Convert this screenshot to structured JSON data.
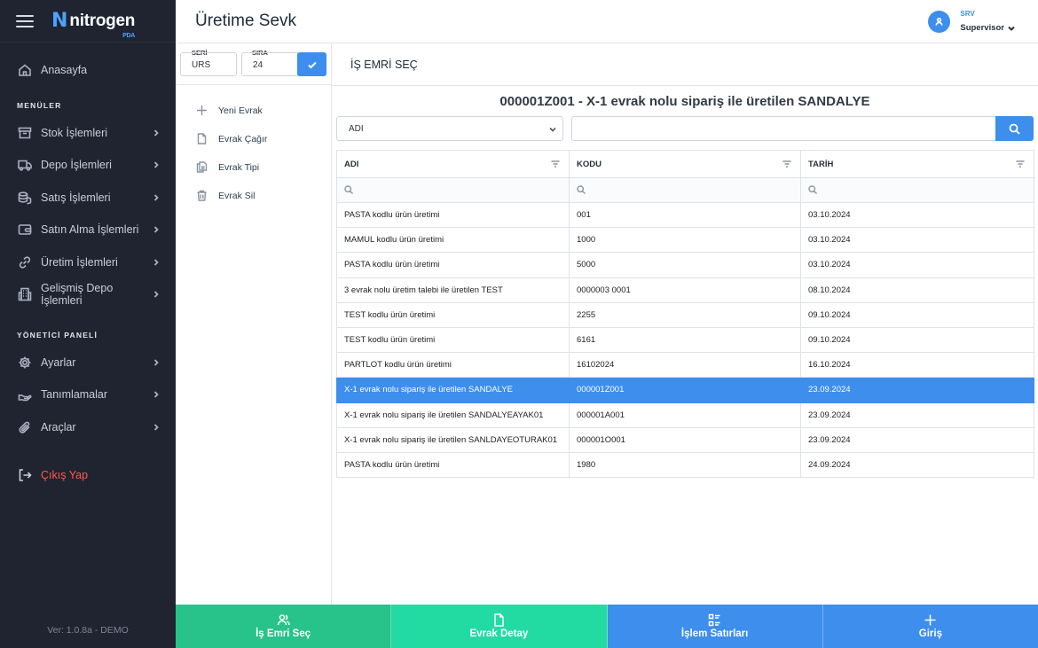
{
  "brand": {
    "name": "nitrogen",
    "sub": "PDA",
    "colors": {
      "accent": "#3d8eed",
      "sidebar": "#1f2430",
      "green": "#27c38a",
      "teal": "#22dba3",
      "danger": "#ff5a4d"
    }
  },
  "sidebar": {
    "home": {
      "label": "Anasayfa",
      "icon": "home-icon"
    },
    "menus_title": "MENÜLER",
    "menus": [
      {
        "label": "Stok İşlemleri",
        "icon": "archive-icon"
      },
      {
        "label": "Depo İşlemleri",
        "icon": "truck-icon"
      },
      {
        "label": "Satış İşlemleri",
        "icon": "coins-icon"
      },
      {
        "label": "Satın Alma İşlemleri",
        "icon": "wallet-icon"
      },
      {
        "label": "Üretim İşlemleri",
        "icon": "link-icon"
      },
      {
        "label": "Gelişmiş Depo İşlemleri",
        "icon": "building-icon"
      }
    ],
    "admin_title": "YÖNETİCİ PANELİ",
    "admin": [
      {
        "label": "Ayarlar",
        "icon": "gear-icon"
      },
      {
        "label": "Tanımlamalar",
        "icon": "hand-icon"
      },
      {
        "label": "Araçlar",
        "icon": "paperclip-icon"
      }
    ],
    "logout": "Çıkış Yap",
    "version": "Ver: 1.0.8a - DEMO"
  },
  "header": {
    "title": "Üretime Sevk",
    "user_code": "SRV",
    "user_name": "Supervisor"
  },
  "doc_fields": {
    "seri_label": "SERİ",
    "seri_value": "URS",
    "sira_label": "SIRA",
    "sira_value": "24"
  },
  "actions": [
    {
      "label": "Yeni Evrak",
      "icon": "plus-icon"
    },
    {
      "label": "Evrak Çağır",
      "icon": "file-icon"
    },
    {
      "label": "Evrak Tipi",
      "icon": "files-icon"
    },
    {
      "label": "Evrak Sil",
      "icon": "trash-icon"
    }
  ],
  "main": {
    "section_title": "İŞ EMRİ SEÇ",
    "order_title": "000001Z001 - X-1 evrak nolu sipariş ile üretilen SANDALYE",
    "filter_field": "ADI",
    "search_placeholder": ""
  },
  "table": {
    "columns": [
      "ADI",
      "KODU",
      "TARİH"
    ],
    "rows": [
      {
        "adi": "PASTA kodlu ürün üretimi",
        "kodu": "001",
        "tarih": "03.10.2024"
      },
      {
        "adi": "MAMUL kodlu ürün üretimi",
        "kodu": "1000",
        "tarih": "03.10.2024"
      },
      {
        "adi": "PASTA kodlu ürün üretimi",
        "kodu": "5000",
        "tarih": "03.10.2024"
      },
      {
        "adi": "3 evrak nolu üretim talebi ile üretilen TEST",
        "kodu": "0000003 0001",
        "tarih": "08.10.2024"
      },
      {
        "adi": "TEST kodlu ürün üretimi",
        "kodu": "2255",
        "tarih": "09.10.2024"
      },
      {
        "adi": "TEST kodlu ürün üretimi",
        "kodu": "6161",
        "tarih": "09.10.2024"
      },
      {
        "adi": "PARTLOT kodlu ürün üretimi",
        "kodu": "16102024",
        "tarih": "16.10.2024"
      },
      {
        "adi": "X-1 evrak nolu sipariş ile üretilen SANDALYE",
        "kodu": "000001Z001",
        "tarih": "23.09.2024",
        "selected": true
      },
      {
        "adi": "X-1 evrak nolu sipariş ile üretilen SANDALYEAYAK01",
        "kodu": "000001A001",
        "tarih": "23.09.2024"
      },
      {
        "adi": "X-1 evrak nolu sipariş ile üretilen SANLDAYEOTURAK01",
        "kodu": "000001O001",
        "tarih": "23.09.2024"
      },
      {
        "adi": "PASTA kodlu ürün üretimi",
        "kodu": "1980",
        "tarih": "24.09.2024"
      }
    ]
  },
  "bottom_bar": [
    {
      "label": "İş Emri Seç",
      "icon": "users-icon",
      "color": "#27c38a"
    },
    {
      "label": "Evrak Detay",
      "icon": "file-icon",
      "color": "#22dba3"
    },
    {
      "label": "İşlem Satırları",
      "icon": "list-icon",
      "color": "#3d8eed"
    },
    {
      "label": "Giriş",
      "icon": "plus-icon",
      "color": "#3d8eed"
    }
  ]
}
